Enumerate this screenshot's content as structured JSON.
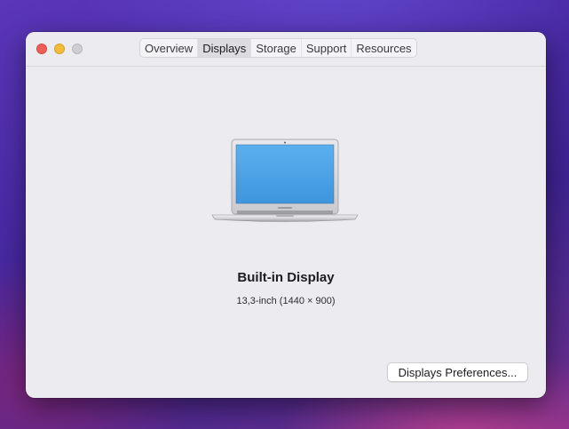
{
  "window": {
    "tabs": [
      {
        "label": "Overview",
        "selected": false
      },
      {
        "label": "Displays",
        "selected": true
      },
      {
        "label": "Storage",
        "selected": false
      },
      {
        "label": "Support",
        "selected": false
      },
      {
        "label": "Resources",
        "selected": false
      }
    ]
  },
  "display": {
    "name": "Built-in Display",
    "spec": "13,3-inch (1440 × 900)",
    "icon": "laptop-icon"
  },
  "actions": {
    "prefs_label": "Displays Preferences..."
  },
  "colors": {
    "close": "#ec5f58",
    "minimize": "#f2bb3b",
    "zoom_inactive": "#cfced2",
    "screen": "#4fa3e6"
  }
}
